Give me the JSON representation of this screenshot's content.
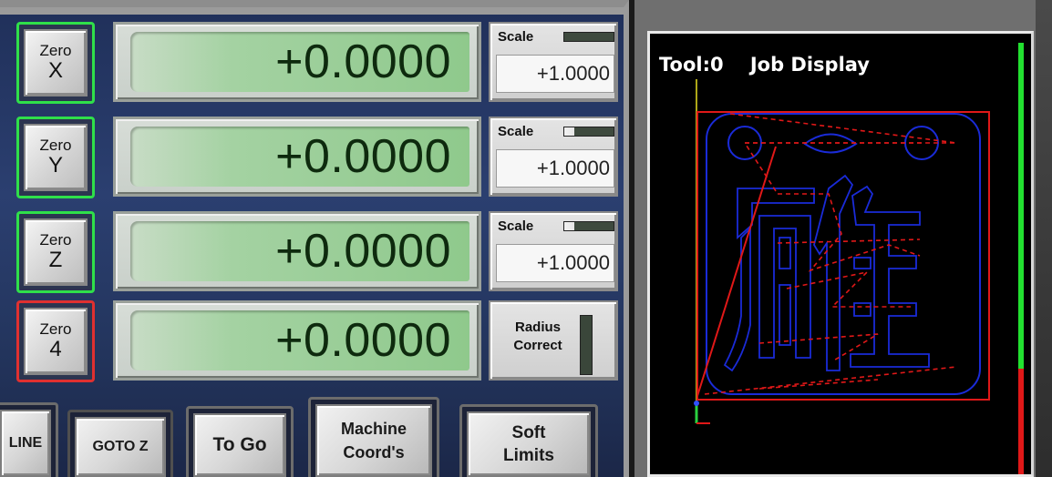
{
  "axes": [
    {
      "zero_label": "Zero",
      "axis": "X",
      "value": "+0.0000",
      "control": "scale",
      "scale_label": "Scale",
      "scale_value": "+1.0000",
      "border": "green"
    },
    {
      "zero_label": "Zero",
      "axis": "Y",
      "value": "+0.0000",
      "control": "scale",
      "scale_label": "Scale",
      "scale_value": "+1.0000",
      "border": "green"
    },
    {
      "zero_label": "Zero",
      "axis": "Z",
      "value": "+0.0000",
      "control": "scale",
      "scale_label": "Scale",
      "scale_value": "+1.0000",
      "border": "green"
    },
    {
      "zero_label": "Zero",
      "axis": "4",
      "value": "+0.0000",
      "control": "radius",
      "radius_label_1": "Radius",
      "radius_label_2": "Correct",
      "border": "red"
    }
  ],
  "buttons": {
    "line": "LINE",
    "goto_z": "GOTO Z",
    "to_go": "To Go",
    "machine_coords_1": "Machine",
    "machine_coords_2": "Coord's",
    "soft_limits_1": "Soft",
    "soft_limits_2": "Limits"
  },
  "job_display": {
    "title": "Tool:0    Job Display"
  },
  "colors": {
    "border_green": "#2fe04a",
    "border_red": "#e03030",
    "lcd_text": "#0e2a0e",
    "toolpath_blue": "#1a2bd8",
    "toolpath_red": "#e01818",
    "axis_yellow": "#e8e020"
  }
}
